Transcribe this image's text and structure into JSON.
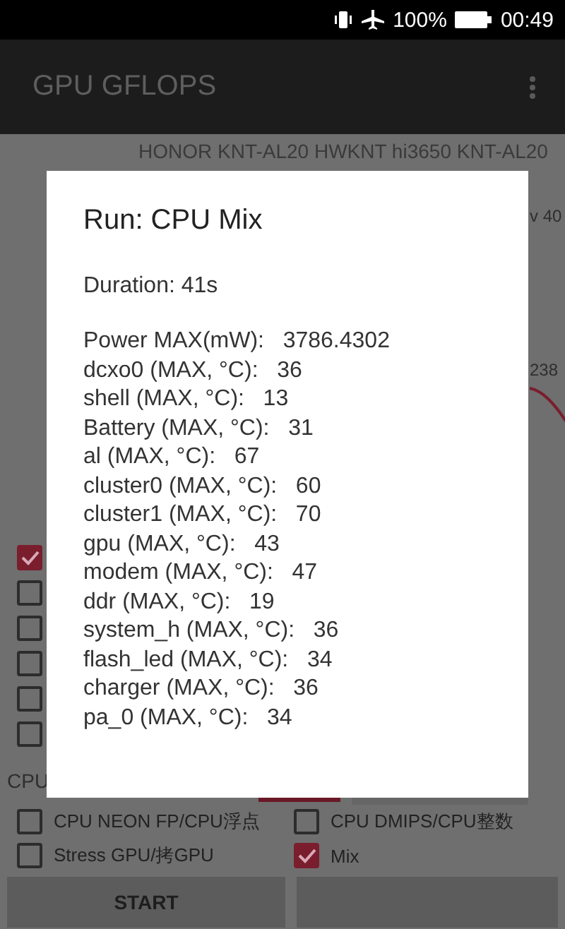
{
  "status_bar": {
    "battery": "100%",
    "time": "00:49"
  },
  "app_bar": {
    "title": "GPU GFLOPS"
  },
  "device_info": "HONOR KNT-AL20 HWKNT hi3650 KNT-AL20",
  "chart_peek": [
    "v 40",
    "238"
  ],
  "side_checkboxes": [
    {
      "checked": true
    },
    {
      "checked": false
    },
    {
      "checked": false
    },
    {
      "checked": false
    },
    {
      "checked": false
    },
    {
      "checked": false
    }
  ],
  "section_label": "CPU",
  "options": [
    {
      "label": "CPU NEON FP/CPU浮点",
      "checked": false
    },
    {
      "label": "CPU DMIPS/CPU整数",
      "checked": false
    },
    {
      "label": "Stress GPU/拷GPU",
      "checked": false
    },
    {
      "label": "Mix",
      "checked": true
    }
  ],
  "buttons": [
    {
      "label": "START"
    }
  ],
  "dialog": {
    "title": "Run: CPU Mix",
    "duration": "Duration: 41s",
    "stats": [
      {
        "label": "Power MAX(mW):",
        "value": "3786.4302"
      },
      {
        "label": "dcxo0 (MAX, °C):",
        "value": "36"
      },
      {
        "label": "shell (MAX, °C):",
        "value": "13"
      },
      {
        "label": "Battery (MAX, °C):",
        "value": "31"
      },
      {
        "label": "al (MAX, °C):",
        "value": "67"
      },
      {
        "label": "cluster0 (MAX, °C):",
        "value": "60"
      },
      {
        "label": "cluster1 (MAX, °C):",
        "value": "70"
      },
      {
        "label": "gpu (MAX, °C):",
        "value": "43"
      },
      {
        "label": "modem (MAX, °C):",
        "value": "47"
      },
      {
        "label": "ddr (MAX, °C):",
        "value": "19"
      },
      {
        "label": "system_h (MAX, °C):",
        "value": "36"
      },
      {
        "label": "flash_led (MAX, °C):",
        "value": "34"
      },
      {
        "label": "charger (MAX, °C):",
        "value": "36"
      },
      {
        "label": "pa_0 (MAX, °C):",
        "value": "34"
      }
    ]
  }
}
